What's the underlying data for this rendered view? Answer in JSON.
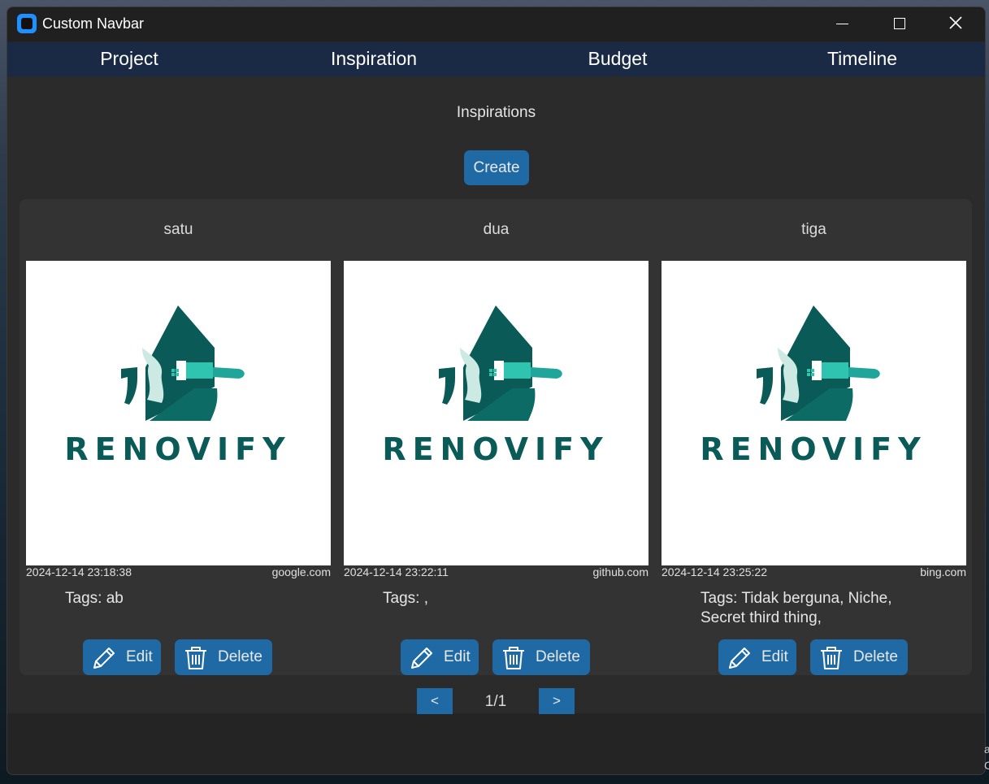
{
  "window": {
    "title": "Custom Navbar"
  },
  "nav": {
    "items": [
      "Project",
      "Inspiration",
      "Budget",
      "Timeline"
    ]
  },
  "page": {
    "heading": "Inspirations",
    "create_label": "Create"
  },
  "cards": [
    {
      "title": "satu",
      "logo_text": "RENOVIFY",
      "date": "2024-12-14 23:18:38",
      "link": "google.com",
      "tags": "Tags: ab",
      "edit_label": "Edit",
      "delete_label": "Delete"
    },
    {
      "title": "dua",
      "logo_text": "RENOVIFY",
      "date": "2024-12-14 23:22:11",
      "link": "github.com",
      "tags": "Tags: ,",
      "edit_label": "Edit",
      "delete_label": "Delete"
    },
    {
      "title": "tiga",
      "logo_text": "RENOVIFY",
      "date": "2024-12-14 23:25:22",
      "link": "bing.com",
      "tags": "Tags: Tidak berguna, Niche, Secret third thing,",
      "edit_label": "Edit",
      "delete_label": "Delete"
    }
  ],
  "pagination": {
    "prev": "<",
    "next": ">",
    "label": "1/1"
  },
  "desktop": {
    "text_line1": "a",
    "text_line2": "C"
  },
  "colors": {
    "accent": "#1f6aa5",
    "navbar": "#1a2944",
    "logo_teal": "#0a5a57",
    "logo_light": "#cce9e3",
    "logo_brush": "#2ec4b0"
  }
}
